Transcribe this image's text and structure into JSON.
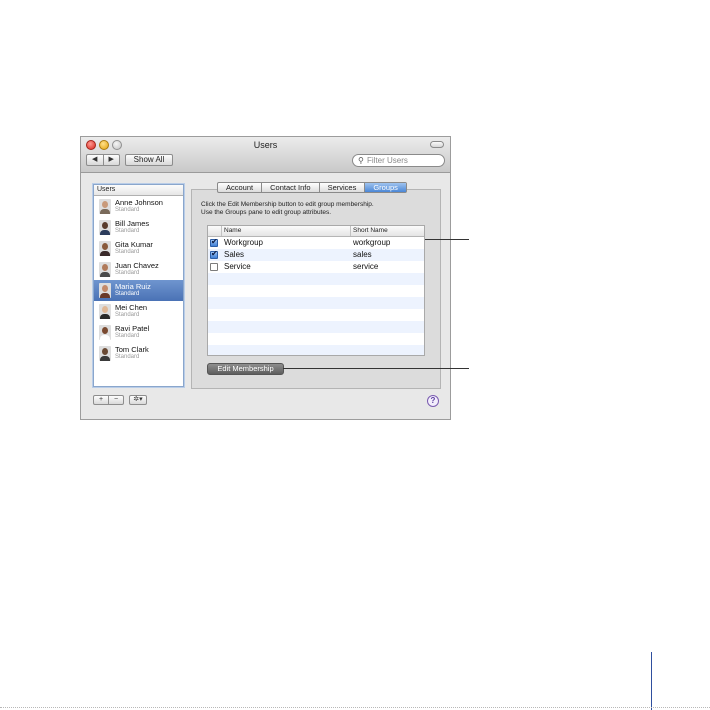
{
  "window": {
    "title": "Users"
  },
  "toolbar": {
    "back": "◀",
    "forward": "▶",
    "show_all": "Show All",
    "search_placeholder": "Filter Users"
  },
  "users": {
    "header": "Users",
    "items": [
      {
        "name": "Anne Johnson",
        "role": "Standard",
        "selected": false,
        "skin": "#c99a7a",
        "shirt": "#7a6a5a"
      },
      {
        "name": "Bill James",
        "role": "Standard",
        "selected": false,
        "skin": "#5a3c2c",
        "shirt": "#2c3c5c"
      },
      {
        "name": "Gita Kumar",
        "role": "Standard",
        "selected": false,
        "skin": "#8a5a3c",
        "shirt": "#3a2a2a"
      },
      {
        "name": "Juan Chavez",
        "role": "Standard",
        "selected": false,
        "skin": "#b07a5a",
        "shirt": "#4a4a4a"
      },
      {
        "name": "Maria Ruiz",
        "role": "Standard",
        "selected": true,
        "skin": "#c48a6a",
        "shirt": "#6a3a2a"
      },
      {
        "name": "Mei Chen",
        "role": "Standard",
        "selected": false,
        "skin": "#e0b896",
        "shirt": "#2a2a2a"
      },
      {
        "name": "Ravi Patel",
        "role": "Standard",
        "selected": false,
        "skin": "#7a4a30",
        "shirt": "#ffffff"
      },
      {
        "name": "Tom Clark",
        "role": "Standard",
        "selected": false,
        "skin": "#6a4a34",
        "shirt": "#3a3a3a"
      }
    ]
  },
  "bottom": {
    "add": "+",
    "remove": "−",
    "action": "✲▾",
    "help": "?"
  },
  "tabs": [
    "Account",
    "Contact Info",
    "Services",
    "Groups"
  ],
  "active_tab": "Groups",
  "groups_pane": {
    "instructions": [
      "Click the Edit Membership button to edit group membership.",
      "Use the Groups pane to edit group attributes."
    ],
    "columns": [
      "Name",
      "Short Name"
    ],
    "rows": [
      {
        "checked": true,
        "name": "Workgroup",
        "short": "workgroup"
      },
      {
        "checked": true,
        "name": "Sales",
        "short": "sales"
      },
      {
        "checked": false,
        "name": "Service",
        "short": "service"
      },
      {
        "checked": false,
        "name": "",
        "short": ""
      },
      {
        "checked": false,
        "name": "",
        "short": ""
      },
      {
        "checked": false,
        "name": "",
        "short": ""
      },
      {
        "checked": false,
        "name": "",
        "short": ""
      },
      {
        "checked": false,
        "name": "",
        "short": ""
      },
      {
        "checked": false,
        "name": "",
        "short": ""
      },
      {
        "checked": false,
        "name": "",
        "short": ""
      }
    ],
    "edit_button": "Edit Membership"
  }
}
